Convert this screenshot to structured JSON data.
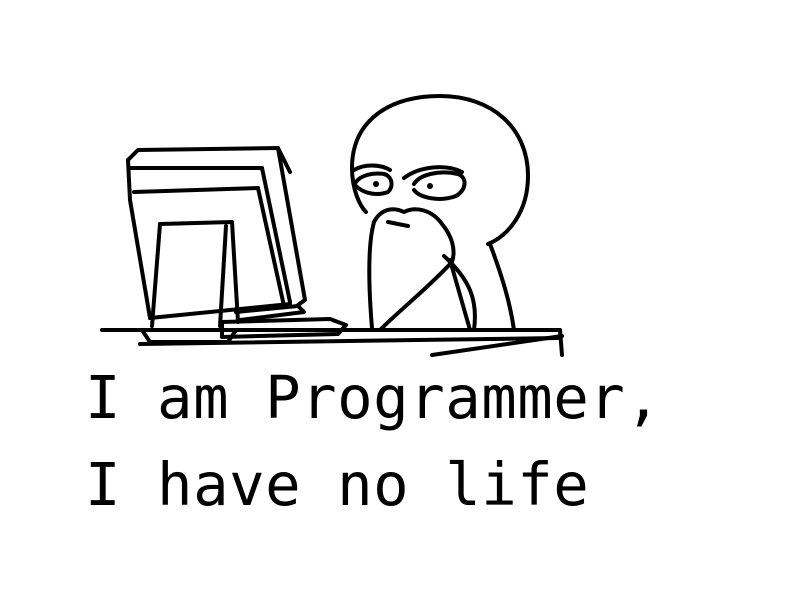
{
  "caption": {
    "line_1": "I am Programmer,",
    "line_2": "I have no life"
  },
  "colors": {
    "ink": "#000000",
    "background": "#ffffff"
  },
  "illustration": {
    "subject_icon": "stickman-at-computer-icon"
  }
}
